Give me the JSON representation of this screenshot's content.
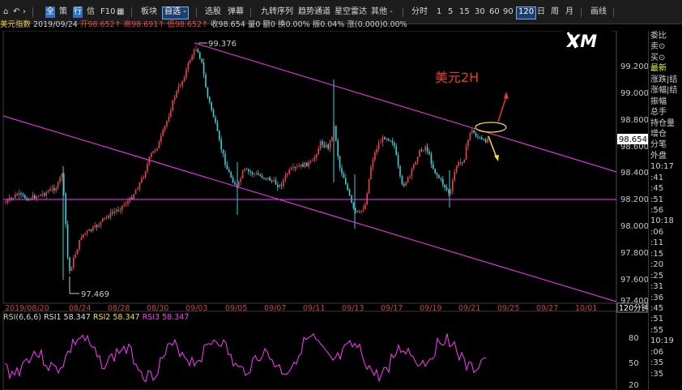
{
  "toolbar": {
    "items": [
      {
        "id": "chart-type",
        "label": "全",
        "style": "blue"
      },
      {
        "id": "strategy",
        "label": "策"
      },
      {
        "id": "trade",
        "label": "行",
        "style": "blue"
      },
      {
        "id": "info",
        "label": "信"
      },
      {
        "id": "f10",
        "label": "F10"
      },
      {
        "id": "layout",
        "label": ""
      },
      {
        "id": "sector",
        "label": "板块"
      },
      {
        "id": "favorite",
        "label": "自选 -",
        "style": "selected"
      },
      {
        "id": "pick-stock",
        "label": "选股"
      },
      {
        "id": "popup",
        "label": "弹幕"
      },
      {
        "id": "nine-turn",
        "label": "九转序列"
      },
      {
        "id": "trend-channel",
        "label": "趋势通道"
      },
      {
        "id": "star-radar",
        "label": "星空雷达"
      },
      {
        "id": "others",
        "label": "其他 -"
      },
      {
        "id": "intraday",
        "label": "分时"
      },
      {
        "id": "p1",
        "label": "1"
      },
      {
        "id": "p5",
        "label": "5"
      },
      {
        "id": "p15",
        "label": "15"
      },
      {
        "id": "p30",
        "label": "30"
      },
      {
        "id": "p60",
        "label": "60"
      },
      {
        "id": "p90",
        "label": "90"
      },
      {
        "id": "p120",
        "label": "120",
        "style": "selected"
      },
      {
        "id": "day",
        "label": "日"
      },
      {
        "id": "week",
        "label": "周"
      },
      {
        "id": "month",
        "label": "月"
      },
      {
        "id": "draw-line",
        "label": "画线"
      }
    ]
  },
  "infobar": {
    "name": "美元指数",
    "date": "2019/09/24",
    "open": "开98.652↑",
    "high": "高98.691↑",
    "low": "低98.652↑",
    "close": "收98.654",
    "volume": "量0",
    "amount": "额0",
    "turnover": "换0.00%",
    "amplitude": "振0.04%",
    "change": "涨(0.000)0.00%"
  },
  "chart": {
    "logo": "XM",
    "annotation": "美元2H",
    "high_marker": "99.376",
    "low_marker": "97.469",
    "current_price": "98.654",
    "period_label": "120分钟",
    "price_axis": [
      "99.200",
      "99.000",
      "98.800",
      "98.600",
      "98.400",
      "98.200",
      "98.000",
      "97.800",
      "97.600",
      "97.400"
    ],
    "date_axis": [
      "2019/08/20",
      "08/24",
      "08/28",
      "08/30",
      "09/03",
      "09/05",
      "09/07",
      "09/11",
      "09/13",
      "09/17",
      "09/19",
      "09/21",
      "09/25",
      "09/27",
      "10/01"
    ]
  },
  "colors": {
    "up": "#e8464a",
    "down": "#38d0d8",
    "channel": "#ff38ff",
    "rsi": "#ff38ff",
    "axis_text": "#c8c8c8",
    "annotation": "#e83a2a"
  },
  "rsi": {
    "title": "RSI(6,6,6)",
    "rsi1": "RSI1 58.347",
    "rsi2": "RSI2 58.347",
    "rsi3": "RSI3 58.347",
    "axis": [
      "80",
      "50",
      "20"
    ]
  },
  "sidepanel": {
    "rows": [
      "委比",
      "卖⊙",
      "买⊙",
      "最新",
      "涨跌|结",
      "涨幅|结",
      "振幅",
      "总手",
      "持仓量",
      "增仓",
      "分笔",
      "外盘",
      "10:17",
      ":41",
      ":45",
      ":51",
      ":56",
      "10:18",
      ":06",
      ":11",
      ":15",
      ":20",
      ":25",
      ":31",
      ":36",
      ":45",
      ":51",
      ":55",
      "10:19",
      ":06",
      ":35",
      ":35"
    ]
  }
}
